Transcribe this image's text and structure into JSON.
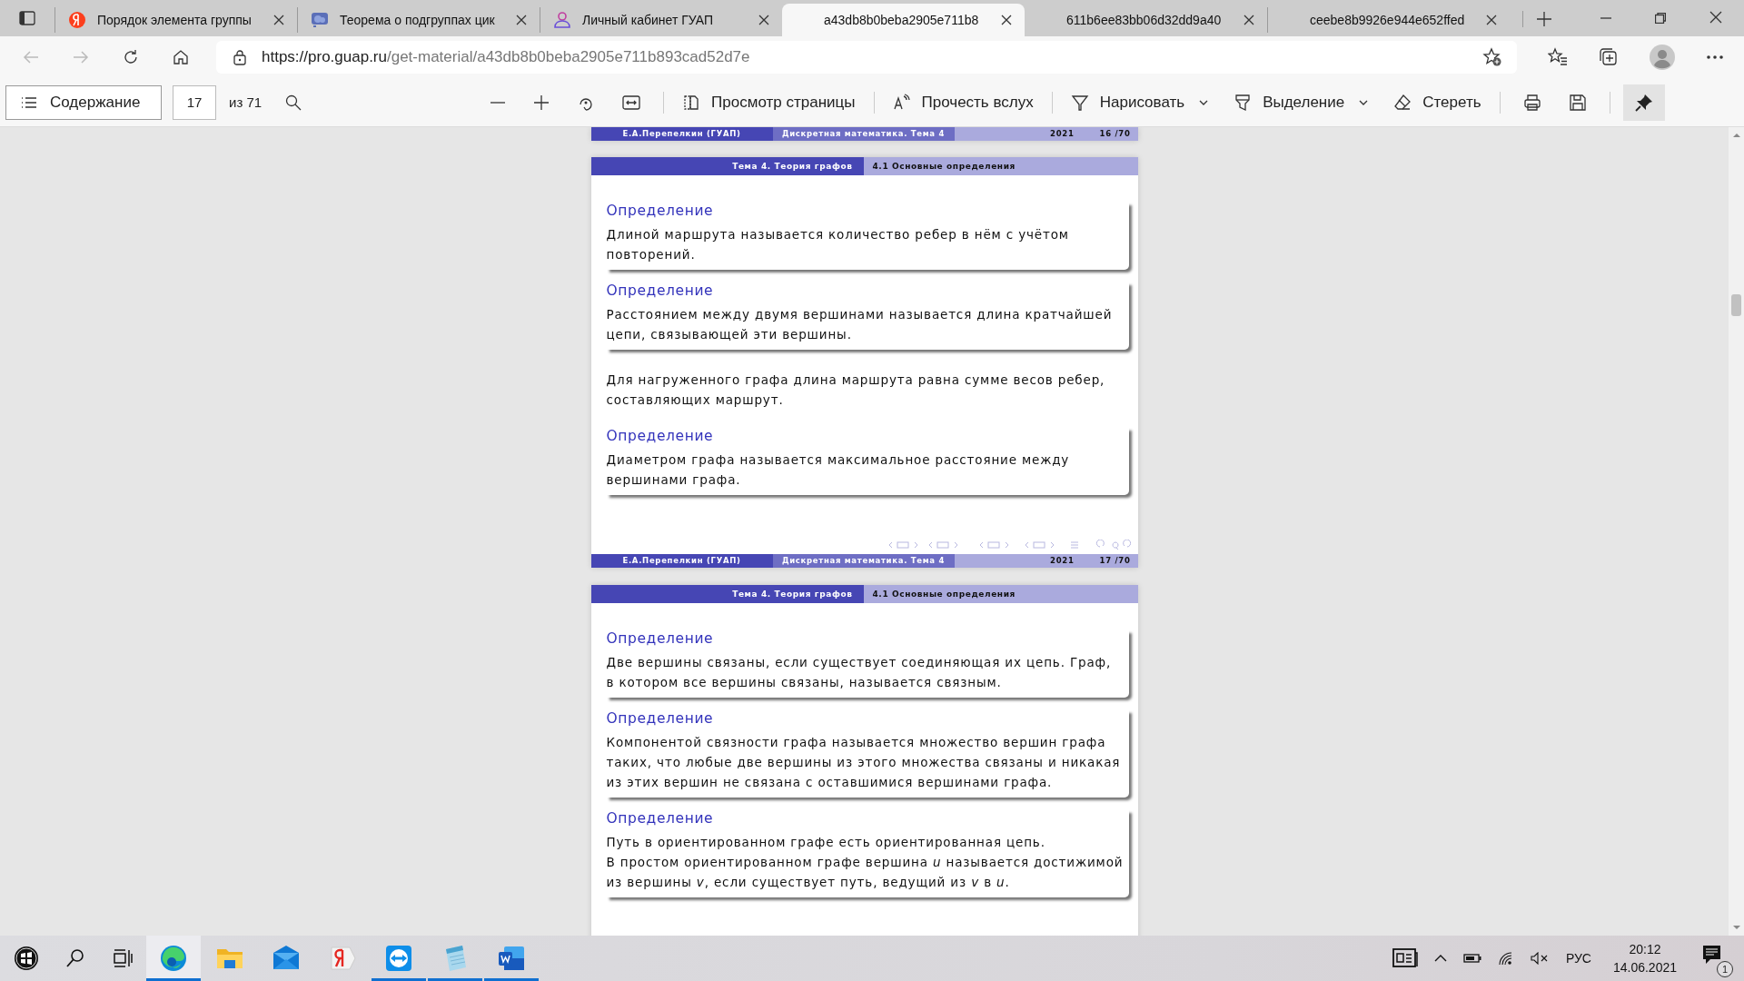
{
  "browser": {
    "tabs": [
      {
        "title": "Порядок элемента группы",
        "selected": false
      },
      {
        "title": "Теорема о подгруппах цик",
        "selected": false
      },
      {
        "title": "Личный кабинет ГУАП",
        "selected": false
      },
      {
        "title": "a43db8b0beba2905e711b8",
        "selected": true
      },
      {
        "title": "611b6ee83bb06d32dd9a40",
        "selected": false
      },
      {
        "title": "ceebe8b9926e944e652ffed",
        "selected": false
      }
    ],
    "address": {
      "host": "https://pro.guap.ru",
      "path": "/get-material/a43db8b0beba2905e711b893cad52d7e"
    }
  },
  "pdf_toolbar": {
    "contents": "Содержание",
    "page": "17",
    "page_total": "из 71",
    "page_view": "Просмотр страницы",
    "read_aloud": "Прочесть вслух",
    "draw": "Нарисовать",
    "highlight": "Выделение",
    "erase": "Стереть",
    "pinned": true
  },
  "slides": [
    {
      "footer": {
        "author": "Е.А.Перепелкин (ГУАП)",
        "course": "Дискретная математика. Тема 4",
        "year": "2021",
        "page": "16 /70"
      }
    },
    {
      "header": {
        "section": "Тема 4. Теория графов",
        "subsection": "4.1 Основные определения"
      },
      "blocks": [
        {
          "kind": "definition",
          "title": "Определение",
          "paragraphs": [
            "Длиной маршрута называется количество ребер в нём с учётом повторений."
          ]
        },
        {
          "kind": "definition",
          "title": "Определение",
          "paragraphs": [
            "Расстоянием между двумя вершинами называется длина кратчайшей цепи, связывающей эти вершины."
          ]
        },
        {
          "kind": "text",
          "paragraphs": [
            "Для нагруженного графа длина маршрута равна сумме весов ребер, составляющих маршрут."
          ]
        },
        {
          "kind": "definition",
          "title": "Определение",
          "paragraphs": [
            "Диаметром графа называется максимальное расстояние между вершинами графа."
          ]
        }
      ],
      "footer": {
        "author": "Е.А.Перепелкин (ГУАП)",
        "course": "Дискретная математика. Тема 4",
        "year": "2021",
        "page": "17 /70"
      }
    },
    {
      "header": {
        "section": "Тема 4. Теория графов",
        "subsection": "4.1 Основные определения"
      },
      "blocks": [
        {
          "kind": "definition",
          "title": "Определение",
          "paragraphs": [
            "Две вершины связаны, если существует соединяющая их цепь. Граф, в котором все вершины связаны, называется связным."
          ]
        },
        {
          "kind": "definition",
          "title": "Определение",
          "paragraphs": [
            "Компонентой связности графа называется множество вершин графа таких, что любые две вершины из этого множества связаны и никакая из этих вершин не связана с оставшимися вершинами графа."
          ]
        },
        {
          "kind": "definition",
          "title": "Определение",
          "paragraphs": [
            "Путь в ориентированном графе есть ориентированная цепь.",
            "В простом ориентированном графе вершина *u* называется достижимой из вершины *v*, если существует путь, ведущий из *v* в *u*."
          ]
        }
      ]
    }
  ],
  "taskbar": {
    "apps": [
      {
        "running": true,
        "selected": true
      },
      {
        "running": false,
        "selected": false
      },
      {
        "running": false,
        "selected": false
      },
      {
        "running": false,
        "selected": false
      },
      {
        "running": true,
        "selected": false
      },
      {
        "running": true,
        "selected": false
      },
      {
        "running": true,
        "selected": false
      }
    ],
    "language": "РУС",
    "time": "20:12",
    "date": "14.06.2021",
    "notifications": "1"
  }
}
